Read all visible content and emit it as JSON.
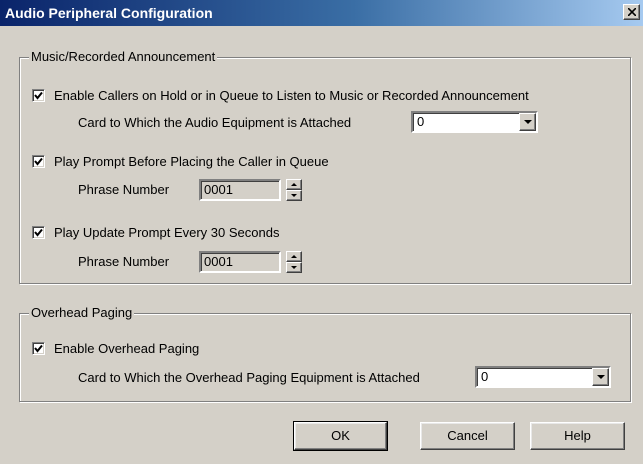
{
  "window": {
    "title": "Audio Peripheral Configuration"
  },
  "music_group": {
    "legend": "Music/Recorded Announcement",
    "enable_callers": {
      "label": "Enable Callers on Hold or in Queue to Listen to Music or Recorded Announcement",
      "checked": true
    },
    "card_label": "Card to Which the Audio Equipment is Attached",
    "card_value": "0",
    "play_prompt": {
      "label": "Play Prompt Before Placing the Caller in Queue",
      "checked": true
    },
    "phrase_label_1": "Phrase Number",
    "phrase_value_1": "0001",
    "update_prompt": {
      "label": "Play Update Prompt Every 30 Seconds",
      "checked": true
    },
    "phrase_label_2": "Phrase Number",
    "phrase_value_2": "0001"
  },
  "paging_group": {
    "legend": "Overhead Paging",
    "enable_paging": {
      "label": "Enable Overhead Paging",
      "checked": true
    },
    "card_label": "Card to Which the Overhead Paging Equipment is Attached",
    "card_value": "0"
  },
  "buttons": {
    "ok": "OK",
    "cancel": "Cancel",
    "help": "Help"
  },
  "icons": [
    "close-icon",
    "checkmark-icon",
    "dropdown-arrow-icon",
    "spin-up-icon",
    "spin-down-icon"
  ]
}
